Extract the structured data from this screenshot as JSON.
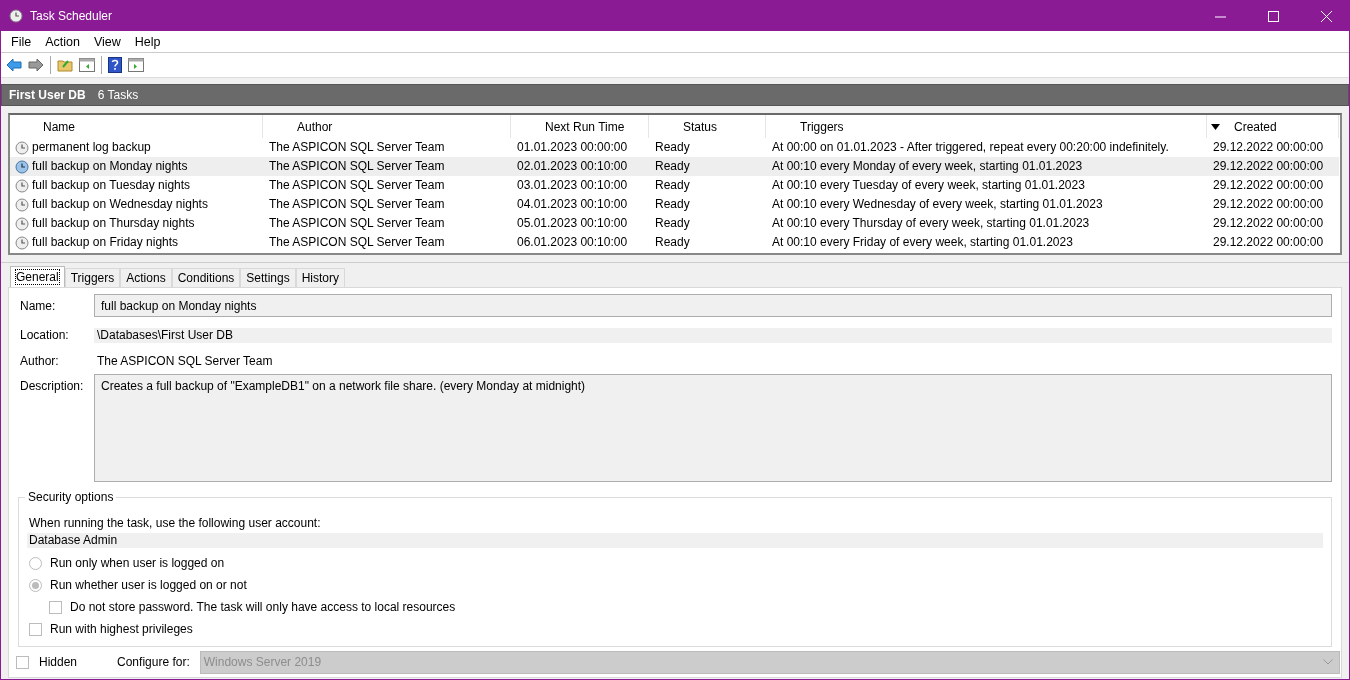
{
  "window": {
    "title": "Task Scheduler"
  },
  "menu": [
    {
      "label": "File"
    },
    {
      "label": "Action"
    },
    {
      "label": "View"
    },
    {
      "label": "Help"
    }
  ],
  "header": {
    "folder": "First User DB",
    "count": "6 Tasks"
  },
  "table": {
    "columns": [
      {
        "label": "Name"
      },
      {
        "label": "Author"
      },
      {
        "label": "Next Run Time"
      },
      {
        "label": "Status"
      },
      {
        "label": "Triggers"
      },
      {
        "label": "Created",
        "sorted_descending": true
      }
    ],
    "rows": [
      {
        "name": "permanent log backup",
        "author": "The ASPICON SQL Server Team",
        "next_run": "01.01.2023 00:00:00",
        "status": "Ready",
        "triggers": "At 00:00 on 01.01.2023 - After triggered, repeat every 00:20:00 indefinitely.",
        "created": "29.12.2022 00:00:00",
        "selected": false
      },
      {
        "name": "full backup on Monday nights",
        "author": "The ASPICON SQL Server Team",
        "next_run": "02.01.2023 00:10:00",
        "status": "Ready",
        "triggers": "At 00:10 every Monday of every week, starting 01.01.2023",
        "created": "29.12.2022 00:00:00",
        "selected": true
      },
      {
        "name": "full backup on Tuesday nights",
        "author": "The ASPICON SQL Server Team",
        "next_run": "03.01.2023 00:10:00",
        "status": "Ready",
        "triggers": "At 00:10 every Tuesday of every week, starting 01.01.2023",
        "created": "29.12.2022 00:00:00",
        "selected": false
      },
      {
        "name": "full backup on Wednesday nights",
        "author": "The ASPICON SQL Server Team",
        "next_run": "04.01.2023 00:10:00",
        "status": "Ready",
        "triggers": "At 00:10 every Wednesday of every week, starting 01.01.2023",
        "created": "29.12.2022 00:00:00",
        "selected": false
      },
      {
        "name": "full backup on Thursday nights",
        "author": "The ASPICON SQL Server Team",
        "next_run": "05.01.2023 00:10:00",
        "status": "Ready",
        "triggers": "At 00:10 every Thursday of every week, starting 01.01.2023",
        "created": "29.12.2022 00:00:00",
        "selected": false
      },
      {
        "name": "full backup on Friday nights",
        "author": "The ASPICON SQL Server Team",
        "next_run": "06.01.2023 00:10:00",
        "status": "Ready",
        "triggers": "At 00:10 every Friday of every week, starting 01.01.2023",
        "created": "29.12.2022 00:00:00",
        "selected": false
      }
    ]
  },
  "tabs": [
    {
      "label": "General",
      "selected": true
    },
    {
      "label": "Triggers",
      "selected": false
    },
    {
      "label": "Actions",
      "selected": false
    },
    {
      "label": "Conditions",
      "selected": false
    },
    {
      "label": "Settings",
      "selected": false
    },
    {
      "label": "History",
      "selected": false
    }
  ],
  "general": {
    "fields": [
      {
        "label": "Name:",
        "value": "full backup on Monday nights",
        "kind": "box"
      },
      {
        "label": "Location:",
        "value": "\\Databases\\First User DB",
        "kind": "strip"
      },
      {
        "label": "Author:",
        "value": "The ASPICON SQL Server Team",
        "kind": "plain"
      },
      {
        "label": "Description:",
        "value": "Creates a full backup of \"ExampleDB1\" on a network file share. (every Monday at midnight)",
        "kind": "area"
      }
    ]
  },
  "security": {
    "legend": "Security options",
    "account_label": "When running the task, use the following user account:",
    "account": "Database Admin",
    "options": [
      {
        "kind": "radio",
        "label": "Run only when user is logged on",
        "selected": false
      },
      {
        "kind": "radio",
        "label": "Run whether user is logged on or not",
        "selected": true,
        "children": [
          {
            "kind": "checkbox",
            "label": "Do not store password.  The task will only have access to local resources",
            "checked": false
          }
        ]
      },
      {
        "kind": "checkbox",
        "label": "Run with highest privileges",
        "checked": false
      }
    ]
  },
  "footer": {
    "hidden": {
      "label": "Hidden",
      "checked": false
    },
    "configure_label": "Configure for:",
    "configure_value": "Windows Server 2019",
    "disabled": true
  }
}
